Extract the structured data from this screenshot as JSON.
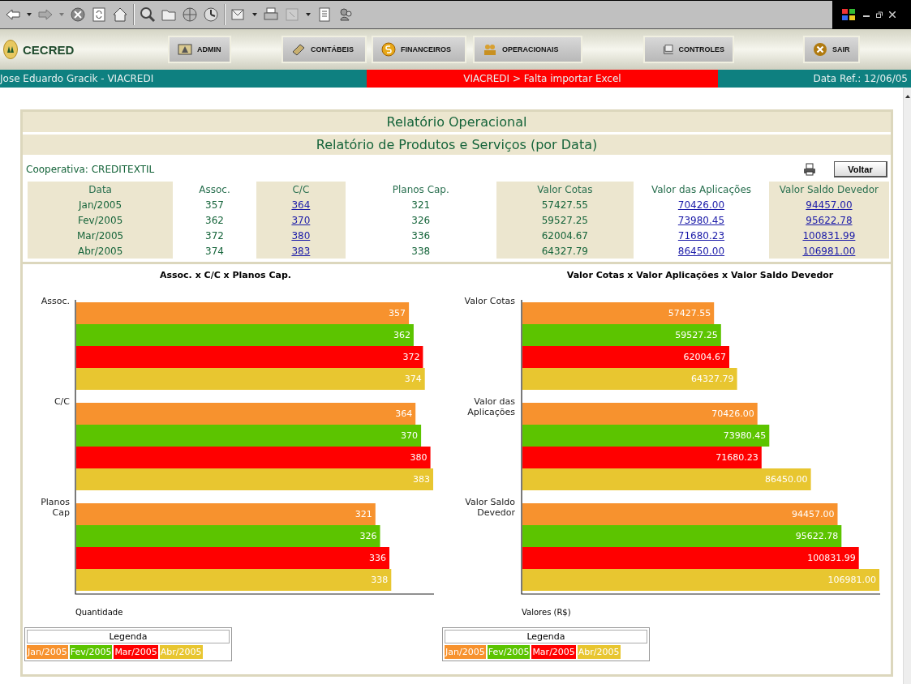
{
  "nav": {
    "logo": "CECRED",
    "buttons": [
      {
        "label": "ADMIN",
        "kind": "admin"
      },
      {
        "label": "CONTÁBEIS",
        "kind": "book"
      },
      {
        "label": "FINANCEIROS",
        "kind": "coin"
      },
      {
        "label": "OPERACIONAIS",
        "kind": "people"
      },
      {
        "label": "CONTROLES",
        "kind": "monitor"
      },
      {
        "label": "SAIR",
        "kind": "exit"
      }
    ]
  },
  "status_bar": {
    "user": "Jose Eduardo Gracik - VIACREDI",
    "alert": "VIACREDI > Falta importar Excel",
    "date": "Data Ref.: 12/06/05"
  },
  "report": {
    "title": "Relatório Operacional",
    "subtitle": "Relatório de Produtos e Serviços (por Data)",
    "cooperative": "Cooperativa: CREDITEXTIL",
    "back_button": "Voltar",
    "table": {
      "columns": [
        "Data",
        "Assoc.",
        "C/C",
        "Planos Cap.",
        "Valor Cotas",
        "Valor das Aplicações",
        "Valor Saldo Devedor"
      ],
      "rows": [
        [
          {
            "text": "Jan/2005",
            "link": false
          },
          {
            "text": "357",
            "link": false
          },
          {
            "text": "364",
            "link": true
          },
          {
            "text": "321",
            "link": false
          },
          {
            "text": "57427.55",
            "link": false
          },
          {
            "text": "70426.00",
            "link": true
          },
          {
            "text": "94457.00",
            "link": true
          }
        ],
        [
          {
            "text": "Fev/2005",
            "link": false
          },
          {
            "text": "362",
            "link": false
          },
          {
            "text": "370",
            "link": true
          },
          {
            "text": "326",
            "link": false
          },
          {
            "text": "59527.25",
            "link": false
          },
          {
            "text": "73980.45",
            "link": true
          },
          {
            "text": "95622.78",
            "link": true
          }
        ],
        [
          {
            "text": "Mar/2005",
            "link": false
          },
          {
            "text": "372",
            "link": false
          },
          {
            "text": "380",
            "link": true
          },
          {
            "text": "336",
            "link": false
          },
          {
            "text": "62004.67",
            "link": false
          },
          {
            "text": "71680.23",
            "link": true
          },
          {
            "text": "100831.99",
            "link": true
          }
        ],
        [
          {
            "text": "Abr/2005",
            "link": false
          },
          {
            "text": "374",
            "link": false
          },
          {
            "text": "383",
            "link": true
          },
          {
            "text": "338",
            "link": false
          },
          {
            "text": "64327.79",
            "link": false
          },
          {
            "text": "86450.00",
            "link": true
          },
          {
            "text": "106981.00",
            "link": true
          }
        ]
      ]
    }
  },
  "charts": [
    {
      "legend_title": "Legenda",
      "chart_data": {
        "type": "bar",
        "orientation": "horizontal",
        "title": "Assoc. x C/C x Planos Cap.",
        "xlabel": "Quantidade",
        "categories": [
          "Assoc.",
          "C/C",
          "Planos Cap"
        ],
        "data_labels": true,
        "series": [
          {
            "name": "Jan/2005",
            "color": "#f7922e",
            "values": [
              357,
              364,
              321
            ],
            "value_labels": [
              "357",
              "364",
              "321"
            ]
          },
          {
            "name": "Fev/2005",
            "color": "#5cc400",
            "values": [
              362,
              370,
              326
            ],
            "value_labels": [
              "362",
              "370",
              "326"
            ]
          },
          {
            "name": "Mar/2005",
            "color": "#ff0000",
            "values": [
              372,
              380,
              336
            ],
            "value_labels": [
              "372",
              "380",
              "336"
            ]
          },
          {
            "name": "Abr/2005",
            "color": "#e8c630",
            "values": [
              374,
              383,
              338
            ],
            "value_labels": [
              "374",
              "383",
              "338"
            ]
          }
        ]
      }
    },
    {
      "legend_title": "Legenda",
      "chart_data": {
        "type": "bar",
        "orientation": "horizontal",
        "title": "Valor Cotas x Valor Aplicações x Valor Saldo Devedor",
        "xlabel": "Valores (R$)",
        "categories": [
          "Valor Cotas",
          "Valor das Aplicações",
          "Valor Saldo Devedor"
        ],
        "data_labels": true,
        "series": [
          {
            "name": "Jan/2005",
            "color": "#f7922e",
            "values": [
              57427.55,
              70426.0,
              94457.0
            ],
            "value_labels": [
              "57427.55",
              "70426.00",
              "94457.00"
            ]
          },
          {
            "name": "Fev/2005",
            "color": "#5cc400",
            "values": [
              59527.25,
              73980.45,
              95622.78
            ],
            "value_labels": [
              "59527.25",
              "73980.45",
              "95622.78"
            ]
          },
          {
            "name": "Mar/2005",
            "color": "#ff0000",
            "values": [
              62004.67,
              71680.23,
              100831.99
            ],
            "value_labels": [
              "62004.67",
              "71680.23",
              "100831.99"
            ]
          },
          {
            "name": "Abr/2005",
            "color": "#e8c630",
            "values": [
              64327.79,
              86450.0,
              106981.0
            ],
            "value_labels": [
              "64327.79",
              "86450.00",
              "106981.00"
            ]
          }
        ]
      }
    }
  ]
}
